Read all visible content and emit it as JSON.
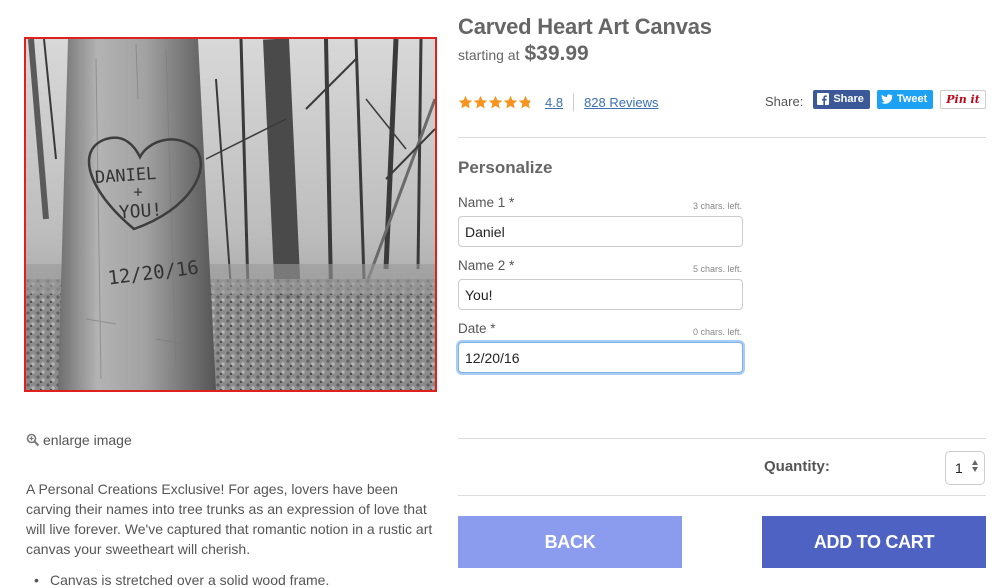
{
  "product": {
    "title": "Carved Heart Art Canvas",
    "price_prefix": "starting at",
    "price": "$39.99",
    "rating_value": 4.8,
    "rating_text": "4.8",
    "reviews_text": "828 Reviews",
    "star_color": "#f7941d"
  },
  "image": {
    "carving_line1": "DANIEL",
    "carving_line2": "+",
    "carving_line3": "YOU!",
    "carving_date": "12/20/16"
  },
  "enlarge_label": "enlarge image",
  "description": "A Personal Creations Exclusive! For ages, lovers have been carving their names into tree trunks as an expression of love that will live forever. We've captured that romantic notion in a rustic art canvas your sweetheart will cherish.",
  "bullets": [
    "Canvas is stretched over a solid wood frame."
  ],
  "share": {
    "label": "Share:",
    "facebook": "Share",
    "twitter": "Tweet",
    "pinterest": "Pin it"
  },
  "personalize": {
    "title": "Personalize",
    "fields": [
      {
        "label": "Name 1 *",
        "chars_left": "3 chars. left.",
        "value": "Daniel"
      },
      {
        "label": "Name 2 *",
        "chars_left": "5 chars. left.",
        "value": "You!"
      },
      {
        "label": "Date *",
        "chars_left": "0 chars. left.",
        "value": "12/20/16"
      }
    ]
  },
  "quantity": {
    "label": "Quantity:",
    "value": "1"
  },
  "buttons": {
    "back": "BACK",
    "add_to_cart": "ADD TO CART"
  },
  "colors": {
    "back_button": "#8b9bee",
    "add_to_cart_button": "#4e62c3",
    "image_border": "#e0201c",
    "link": "#3b6fb6"
  }
}
